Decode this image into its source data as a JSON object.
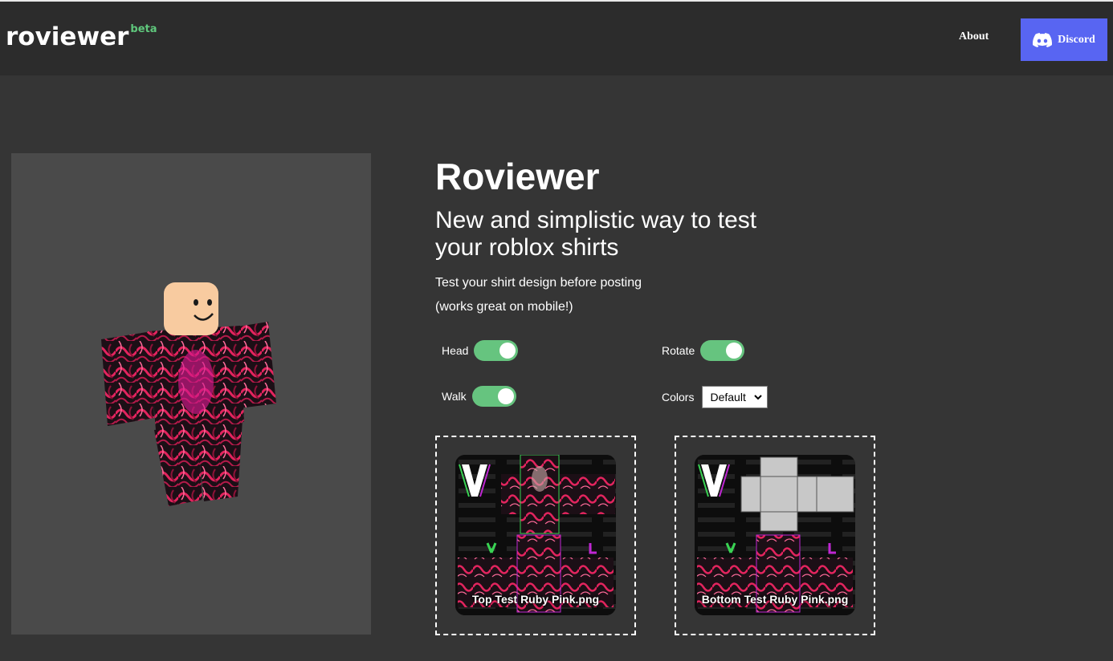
{
  "header": {
    "logo": "roviewer",
    "logo_badge": "beta",
    "nav_about": "About",
    "nav_discord": "Discord"
  },
  "hero": {
    "title": "Roviewer",
    "subtitle": "New and simplistic way to test your roblox shirts",
    "line1": "Test your shirt design before posting",
    "line2": "(works great on mobile!)"
  },
  "controls": {
    "head_label": "Head",
    "head_on": true,
    "rotate_label": "Rotate",
    "rotate_on": true,
    "walk_label": "Walk",
    "walk_on": true,
    "colors_label": "Colors",
    "colors_value": "Default"
  },
  "uploads": {
    "top_file": "Top Test Ruby Pink.png",
    "bottom_file": "Bottom Test Ruby Pink.png"
  },
  "colors": {
    "accent_green": "#66c47f",
    "discord": "#5865f2",
    "background": "#353535",
    "header": "#2c2c2c",
    "viewer": "#4a4a4a"
  },
  "icons": [
    "discord-icon",
    "chevron-down-icon"
  ]
}
